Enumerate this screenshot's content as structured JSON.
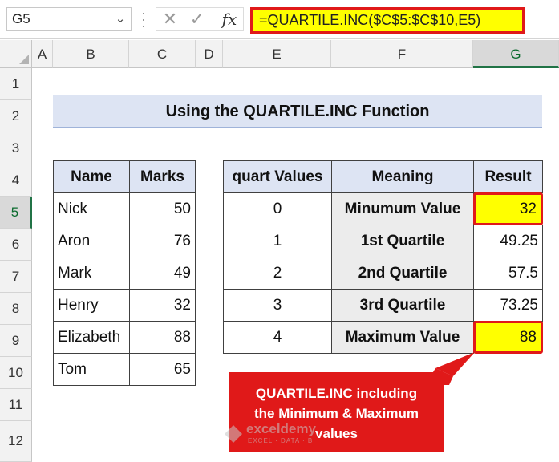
{
  "formula_bar": {
    "name_box": "G5",
    "formula": "=QUARTILE.INC($C$5:$C$10,E5)",
    "fx_label": "fx",
    "cancel_symbol": "✕",
    "enter_symbol": "✓"
  },
  "columns": [
    "A",
    "B",
    "C",
    "D",
    "E",
    "F",
    "G"
  ],
  "rows": [
    "1",
    "2",
    "3",
    "4",
    "5",
    "6",
    "7",
    "8",
    "9",
    "10",
    "11",
    "12"
  ],
  "selected_cell": {
    "column": "G",
    "row": "5"
  },
  "title": "Using the QUARTILE.INC Function",
  "marks_table": {
    "headers": [
      "Name",
      "Marks"
    ],
    "rows": [
      {
        "name": "Nick",
        "marks": "50"
      },
      {
        "name": "Aron",
        "marks": "76"
      },
      {
        "name": "Mark",
        "marks": "49"
      },
      {
        "name": "Henry",
        "marks": "32"
      },
      {
        "name": "Elizabeth",
        "marks": "88"
      },
      {
        "name": "Tom",
        "marks": "65"
      }
    ]
  },
  "quartile_table": {
    "headers": [
      "quart Values",
      "Meaning",
      "Result"
    ],
    "rows": [
      {
        "quart": "0",
        "meaning": "Minumum Value",
        "result": "32"
      },
      {
        "quart": "1",
        "meaning": "1st Quartile",
        "result": "49.25"
      },
      {
        "quart": "2",
        "meaning": "2nd Quartile",
        "result": "57.5"
      },
      {
        "quart": "3",
        "meaning": "3rd Quartile",
        "result": "73.25"
      },
      {
        "quart": "4",
        "meaning": "Maximum Value",
        "result": "88"
      }
    ]
  },
  "callout": {
    "line1": "QUARTILE.INC including",
    "line2": "the Minimum & Maximum",
    "line3": "values"
  },
  "watermark": {
    "brand": "exceldemy",
    "tagline": "EXCEL · DATA · BI"
  },
  "colors": {
    "highlight": "#ffff00",
    "callout_red": "#e01919",
    "header_blue": "#dde4f3",
    "selection_green": "#217346"
  }
}
